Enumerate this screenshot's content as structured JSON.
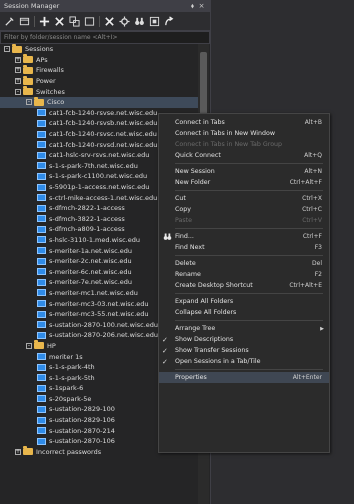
{
  "panel": {
    "title": "Session Manager",
    "pin_glyph": "⬧",
    "close_glyph": "×",
    "filter_placeholder": "Filter by folder/session name <Alt+I>"
  },
  "toolbar": {
    "icons": [
      "properties-icon",
      "new-window-icon",
      "add-icon",
      "delete-icon",
      "copy-icon",
      "new-session-icon",
      "remove-icon",
      "settings-icon",
      "find-icon",
      "quick-connect-icon",
      "arrow-icon"
    ]
  },
  "tree": [
    {
      "level": 0,
      "type": "folder",
      "label": "Sessions",
      "expand": "-"
    },
    {
      "level": 1,
      "type": "folder",
      "label": "APs",
      "expand": "+"
    },
    {
      "level": 1,
      "type": "folder",
      "label": "Firewalls",
      "expand": "+"
    },
    {
      "level": 1,
      "type": "folder",
      "label": "Power",
      "expand": "+"
    },
    {
      "level": 1,
      "type": "folder",
      "label": "Switches",
      "expand": "-"
    },
    {
      "level": 2,
      "type": "folder",
      "label": "Cisco",
      "expand": "-",
      "selected": true
    },
    {
      "level": 3,
      "type": "session",
      "label": "cat1-fcb-1240-rsvse.net.wisc.edu"
    },
    {
      "level": 3,
      "type": "session",
      "label": "cat1-fcb-1240-rsvsb.net.wisc.edu"
    },
    {
      "level": 3,
      "type": "session",
      "label": "cat1-fcb-1240-rsvsc.net.wisc.edu"
    },
    {
      "level": 3,
      "type": "session",
      "label": "cat1-fcb-1240-rsvsd.net.wisc.edu"
    },
    {
      "level": 3,
      "type": "session",
      "label": "cat1-hslc-srv-rsvs.net.wisc.edu"
    },
    {
      "level": 3,
      "type": "session",
      "label": "s-1-s-park-7th.net.wisc.edu"
    },
    {
      "level": 3,
      "type": "session",
      "label": "s-1-s-park-c1100.net.wisc.edu"
    },
    {
      "level": 3,
      "type": "session",
      "label": "s-5901p-1-access.net.wisc.edu"
    },
    {
      "level": 3,
      "type": "session",
      "label": "s-ctrl-mike-access-1.net.wisc.edu"
    },
    {
      "level": 3,
      "type": "session",
      "label": "s-dfmch-2822-1-access"
    },
    {
      "level": 3,
      "type": "session",
      "label": "s-dfmch-3822-1-access"
    },
    {
      "level": 3,
      "type": "session",
      "label": "s-dfmch-a809-1-access"
    },
    {
      "level": 3,
      "type": "session",
      "label": "s-hslc-3110-1.med.wisc.edu"
    },
    {
      "level": 3,
      "type": "session",
      "label": "s-meriter-1a.net.wisc.edu"
    },
    {
      "level": 3,
      "type": "session",
      "label": "s-meriter-2c.net.wisc.edu"
    },
    {
      "level": 3,
      "type": "session",
      "label": "s-meriter-6c.net.wisc.edu"
    },
    {
      "level": 3,
      "type": "session",
      "label": "s-meriter-7e.net.wisc.edu"
    },
    {
      "level": 3,
      "type": "session",
      "label": "s-meriter-mc1.net.wisc.edu"
    },
    {
      "level": 3,
      "type": "session",
      "label": "s-meriter-mc3-03.net.wisc.edu"
    },
    {
      "level": 3,
      "type": "session",
      "label": "s-meriter-mc3-55.net.wisc.edu"
    },
    {
      "level": 3,
      "type": "session",
      "label": "s-ustation-2870-100.net.wisc.edu"
    },
    {
      "level": 3,
      "type": "session",
      "label": "s-ustation-2870-206.net.wisc.edu"
    },
    {
      "level": 2,
      "type": "folder",
      "label": "HP",
      "expand": "-"
    },
    {
      "level": 3,
      "type": "session",
      "label": "meriter 1s"
    },
    {
      "level": 3,
      "type": "session",
      "label": "s-1-s-park-4th"
    },
    {
      "level": 3,
      "type": "session",
      "label": "s-1-s-park-5th"
    },
    {
      "level": 3,
      "type": "session",
      "label": "s-1spark-6"
    },
    {
      "level": 3,
      "type": "session",
      "label": "s-20spark-5e"
    },
    {
      "level": 3,
      "type": "session",
      "label": "s-ustation-2829-100"
    },
    {
      "level": 3,
      "type": "session",
      "label": "s-ustation-2829-106"
    },
    {
      "level": 3,
      "type": "session",
      "label": "s-ustation-2870-214"
    },
    {
      "level": 3,
      "type": "session",
      "label": "s-ustation-2870-106"
    },
    {
      "level": 1,
      "type": "folder",
      "label": "Incorrect passwords",
      "expand": "+"
    }
  ],
  "context_menu": [
    {
      "label": "Connect in Tabs",
      "shortcut": "Alt+B"
    },
    {
      "label": "Connect in Tabs in New Window",
      "shortcut": ""
    },
    {
      "label": "Connect in Tabs in New Tab Group",
      "shortcut": "",
      "disabled": true
    },
    {
      "label": "Quick Connect",
      "shortcut": "Alt+Q"
    },
    {
      "sep": true
    },
    {
      "label": "New Session",
      "shortcut": "Alt+N"
    },
    {
      "label": "New Folder",
      "shortcut": "Ctrl+Alt+F"
    },
    {
      "sep": true
    },
    {
      "label": "Cut",
      "shortcut": "Ctrl+X"
    },
    {
      "label": "Copy",
      "shortcut": "Ctrl+C"
    },
    {
      "label": "Paste",
      "shortcut": "Ctrl+V",
      "disabled": true
    },
    {
      "sep": true
    },
    {
      "label": "Find...",
      "shortcut": "Ctrl+F",
      "icon": "binoculars-icon"
    },
    {
      "label": "Find Next",
      "shortcut": "F3"
    },
    {
      "sep": true
    },
    {
      "label": "Delete",
      "shortcut": "Del"
    },
    {
      "label": "Rename",
      "shortcut": "F2"
    },
    {
      "label": "Create Desktop Shortcut",
      "shortcut": "Ctrl+Alt+E"
    },
    {
      "sep": true
    },
    {
      "label": "Expand All Folders",
      "shortcut": ""
    },
    {
      "label": "Collapse All Folders",
      "shortcut": ""
    },
    {
      "sep": true
    },
    {
      "label": "Arrange Tree",
      "shortcut": "",
      "submenu": true
    },
    {
      "label": "Show Descriptions",
      "shortcut": "",
      "checked": true
    },
    {
      "label": "Show Transfer Sessions",
      "shortcut": "",
      "checked": true
    },
    {
      "label": "Open Sessions in a Tab/Tile",
      "shortcut": "",
      "checked": true
    },
    {
      "sep": true
    },
    {
      "label": "Properties",
      "shortcut": "Alt+Enter",
      "highlighted": true
    }
  ]
}
